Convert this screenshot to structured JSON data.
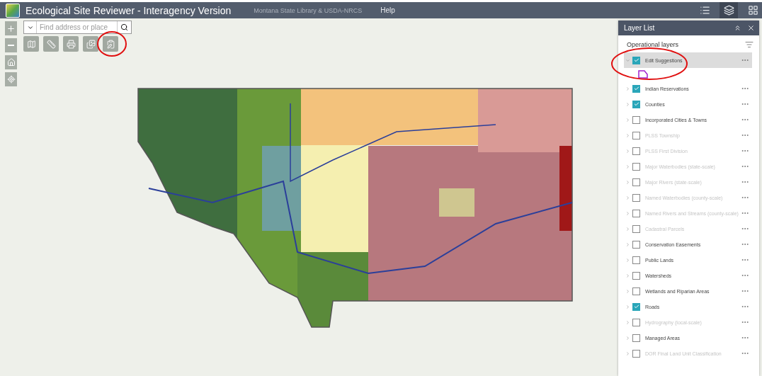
{
  "header": {
    "title": "Ecological Site Reviewer - Interagency Version",
    "links": [
      "Montana State Library & USDA-NRCS",
      "Help"
    ],
    "tools": [
      {
        "kind": "legend",
        "selected": false
      },
      {
        "kind": "layers",
        "selected": true
      },
      {
        "kind": "widgets",
        "selected": false
      }
    ]
  },
  "search": {
    "placeholder": "Find address or place"
  },
  "layer_list": {
    "title": "Layer List",
    "section": "Operational layers",
    "layers": [
      {
        "name": "Edit Suggestions",
        "checked": true,
        "disabled": false,
        "expanded": true,
        "selected": true
      },
      {
        "name": "Indian Reservations",
        "checked": true,
        "disabled": false,
        "expanded": false,
        "selected": false
      },
      {
        "name": "Counties",
        "checked": true,
        "disabled": false,
        "expanded": false,
        "selected": false
      },
      {
        "name": "Incorporated Cities & Towns",
        "checked": false,
        "disabled": false,
        "expanded": false,
        "selected": false
      },
      {
        "name": "PLSS Township",
        "checked": false,
        "disabled": true,
        "expanded": false,
        "selected": false
      },
      {
        "name": "PLSS First Division",
        "checked": false,
        "disabled": true,
        "expanded": false,
        "selected": false
      },
      {
        "name": "Major Waterbodies (state-scale)",
        "checked": false,
        "disabled": true,
        "expanded": false,
        "selected": false
      },
      {
        "name": "Major Rivers (state-scale)",
        "checked": false,
        "disabled": true,
        "expanded": false,
        "selected": false
      },
      {
        "name": "Named Waterbodies (county-scale)",
        "checked": false,
        "disabled": true,
        "expanded": false,
        "selected": false
      },
      {
        "name": "Named Rivers and Streams (county-scale)",
        "checked": false,
        "disabled": true,
        "expanded": false,
        "selected": false
      },
      {
        "name": "Cadastral Parcels",
        "checked": false,
        "disabled": true,
        "expanded": false,
        "selected": false
      },
      {
        "name": "Conservation Easements",
        "checked": false,
        "disabled": false,
        "expanded": false,
        "selected": false
      },
      {
        "name": "Public Lands",
        "checked": false,
        "disabled": false,
        "expanded": false,
        "selected": false
      },
      {
        "name": "Watersheds",
        "checked": false,
        "disabled": false,
        "expanded": false,
        "selected": false
      },
      {
        "name": "Wetlands and Riparian Areas",
        "checked": false,
        "disabled": false,
        "expanded": false,
        "selected": false
      },
      {
        "name": "Roads",
        "checked": true,
        "disabled": false,
        "expanded": false,
        "selected": false
      },
      {
        "name": "Hydrography (local-scale)",
        "checked": false,
        "disabled": true,
        "expanded": false,
        "selected": false
      },
      {
        "name": "Managed Areas",
        "checked": false,
        "disabled": false,
        "expanded": false,
        "selected": false
      },
      {
        "name": "DOR Final Land Unit Classification",
        "checked": false,
        "disabled": true,
        "expanded": false,
        "selected": false
      }
    ]
  }
}
